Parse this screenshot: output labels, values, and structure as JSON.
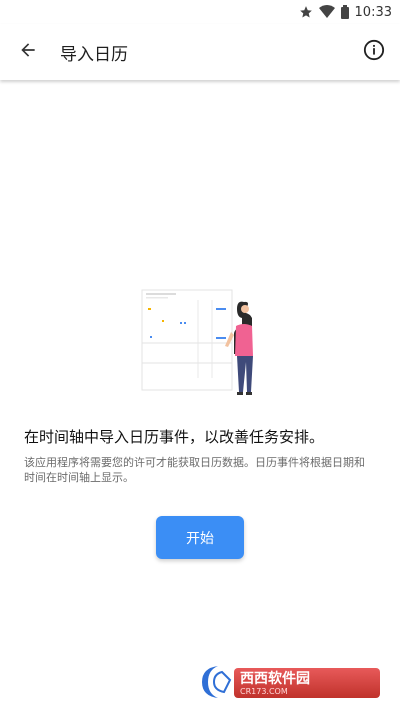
{
  "status_bar": {
    "time": "10:33",
    "icons": [
      "star-icon",
      "wifi-icon",
      "battery-icon"
    ]
  },
  "app_bar": {
    "title": "导入日历",
    "back_icon": "arrow-back-icon",
    "info_icon": "info-icon"
  },
  "content": {
    "headline": "在时间轴中导入日历事件，以改善任务安排。",
    "description": "该应用程序将需要您的许可才能获取日历数据。日历事件将根据日期和时间在时间轴上显示。",
    "start_button": "开始"
  },
  "watermark": {
    "text": "西西软件园",
    "sub": "CR173.COM"
  },
  "colors": {
    "accent": "#3b8ef5",
    "person_shirt": "#f06292",
    "person_pants": "#3f4a7a",
    "watermark_red": "#c0322b"
  }
}
